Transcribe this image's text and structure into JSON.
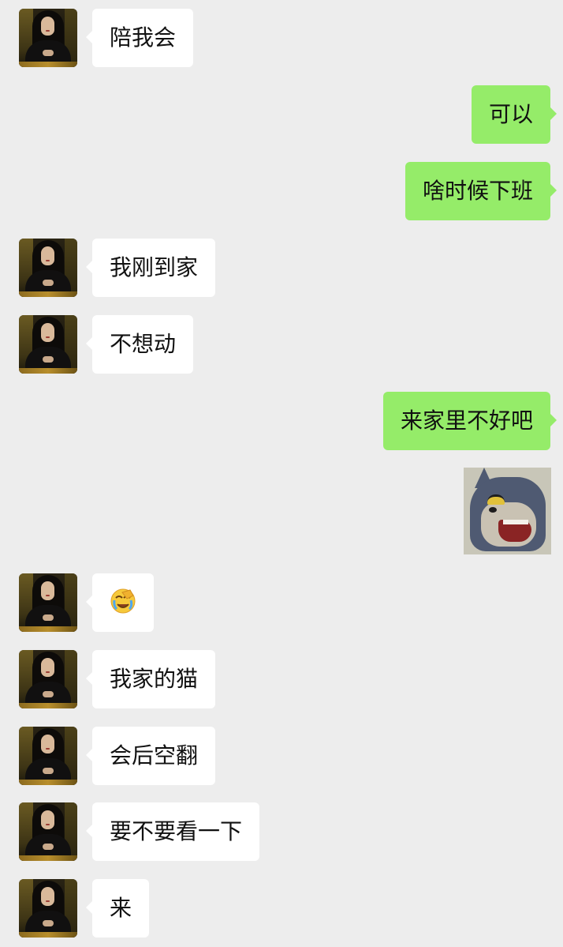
{
  "chat": {
    "messages": [
      {
        "side": "left",
        "text": "陪我会"
      },
      {
        "side": "right",
        "text": "可以"
      },
      {
        "side": "right",
        "text": "啥时候下班"
      },
      {
        "side": "left",
        "text": "我刚到家"
      },
      {
        "side": "left",
        "text": "不想动"
      },
      {
        "side": "right",
        "text": "来家里不好吧"
      },
      {
        "side": "right",
        "type": "sticker",
        "sticker": "tom-cat-smirk-sticker"
      },
      {
        "side": "left",
        "type": "emoji",
        "emoji": "facepalm-crying-emoji"
      },
      {
        "side": "left",
        "text": "我家的猫"
      },
      {
        "side": "left",
        "text": "会后空翻"
      },
      {
        "side": "left",
        "text": "要不要看一下"
      },
      {
        "side": "left",
        "text": "来"
      }
    ]
  },
  "colors": {
    "background": "#ededed",
    "incoming_bubble": "#ffffff",
    "outgoing_bubble": "#95ec69",
    "text": "#111111"
  }
}
